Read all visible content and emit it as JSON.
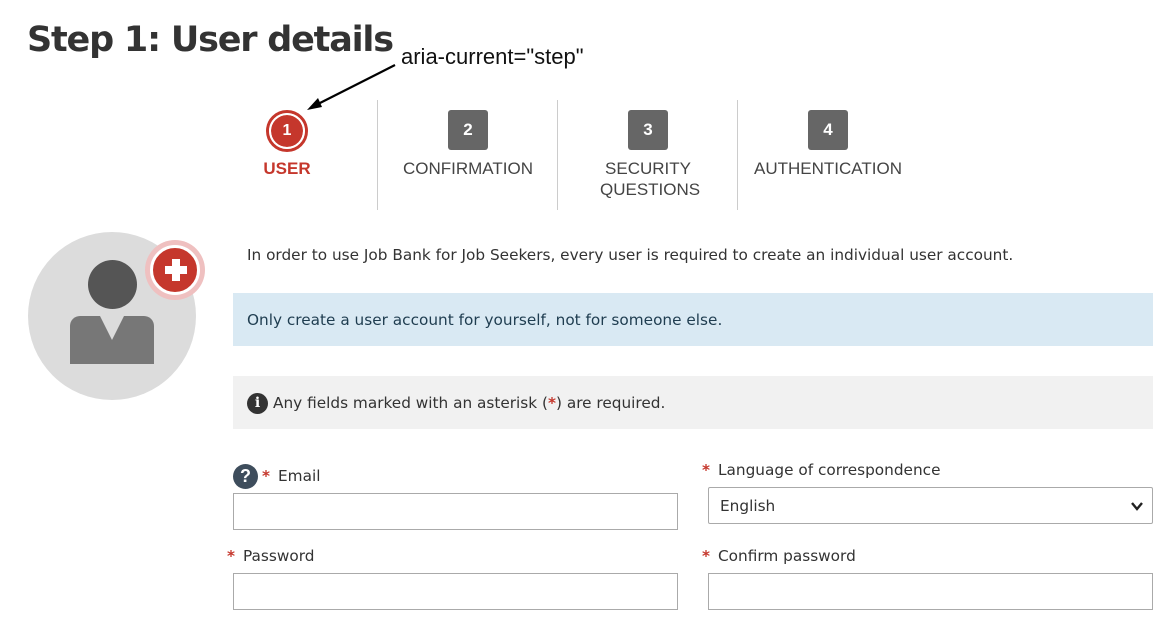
{
  "page": {
    "title": "Step 1: User details",
    "annotation": "aria-current=\"step\""
  },
  "stepper": {
    "steps": [
      {
        "number": "1",
        "label": "USER",
        "current": true
      },
      {
        "number": "2",
        "label": "CONFIRMATION",
        "current": false
      },
      {
        "number": "3",
        "label": "SECURITY QUESTIONS",
        "current": false
      },
      {
        "number": "4",
        "label": "AUTHENTICATION",
        "current": false
      }
    ]
  },
  "intro": "In order to use Job Bank for Job Seekers, every user is required to create an individual user account.",
  "alert": "Only create a user account for yourself, not for someone else.",
  "required_note": {
    "before": "Any fields marked with an asterisk (",
    "star": "*",
    "after": ") are required."
  },
  "form": {
    "required_marker": "*",
    "help_glyph": "?",
    "email": {
      "label": "Email",
      "value": ""
    },
    "language": {
      "label": "Language of correspondence",
      "selected": "English"
    },
    "password": {
      "label": "Password",
      "value": ""
    },
    "confirm_password": {
      "label": "Confirm password",
      "value": ""
    }
  },
  "icons": {
    "avatar": "user-avatar-icon",
    "add": "plus-circle-icon",
    "info": "info-icon",
    "help": "question-mark-icon",
    "select_arrow": "chevron-down-icon"
  },
  "colors": {
    "accent": "#c5372c",
    "step_inactive": "#666666",
    "alert_bg": "#d9e9f3",
    "note_bg": "#f1f1f1"
  }
}
